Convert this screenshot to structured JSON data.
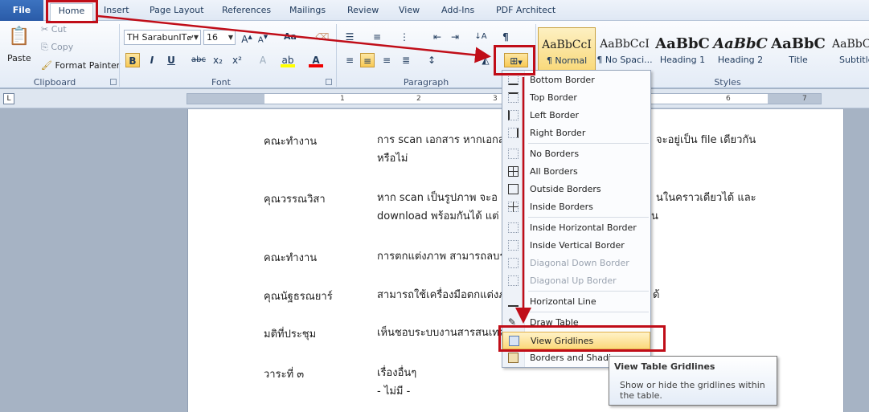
{
  "tabs": [
    "File",
    "Home",
    "Insert",
    "Page Layout",
    "References",
    "Mailings",
    "Review",
    "View",
    "Add-Ins",
    "PDF Architect"
  ],
  "clipboard": {
    "paste": "Paste",
    "cut": "Cut",
    "copy": "Copy",
    "format_painter": "Format Painter",
    "label": "Clipboard"
  },
  "font": {
    "name": "TH SarabunIT๙",
    "size": "16",
    "label": "Font",
    "bold": "B",
    "italic": "I",
    "underline": "U",
    "strike": "abc",
    "sub": "x₂",
    "sup": "x²"
  },
  "paragraph": {
    "label": "Paragraph"
  },
  "styles": {
    "label": "Styles",
    "items": [
      {
        "sample": "AaBbCcI",
        "name": "¶ Normal"
      },
      {
        "sample": "AaBbCcI",
        "name": "¶ No Spaci..."
      },
      {
        "sample": "AaBbC",
        "name": "Heading 1"
      },
      {
        "sample": "AaBbC",
        "name": "Heading 2"
      },
      {
        "sample": "AaBbC",
        "name": "Title"
      },
      {
        "sample": "AaBbC",
        "name": "Subtitle"
      }
    ]
  },
  "ruler": {
    "numbers": [
      "1",
      "2",
      "3",
      "4",
      "5",
      "6",
      "7"
    ]
  },
  "document": {
    "rows": [
      {
        "left": "คณะทำงาน",
        "right": [
          "การ scan เอกสาร หากเอกส",
          "หรือไม่"
        ],
        "right_tail": "จะอยู่เป็น file เดียวกัน"
      },
      {
        "left": "คุณวรรณวิสา",
        "right": [
          "หาก scan เป็นรูปภาพ จะอ",
          "download พร้อมกันได้ แต่"
        ],
        "right_tail": "นในคราวเดียวได้ และ",
        "right_tail2": "น"
      },
      {
        "left": "คณะทำงาน",
        "right": [
          "การตกแต่งภาพ สามารถลบร"
        ]
      },
      {
        "left": "คุณนัฐธรณยาร์",
        "right": [
          "สามารถใช้เครื่องมือตกแต่งภ"
        ],
        "right_tail": "ด้"
      },
      {
        "left": "มติที่ประชุม",
        "right": [
          "เห็นชอบระบบงานสารสนเทศ"
        ]
      },
      {
        "left": "วาระที่ ๓",
        "right": [
          "เรื่องอื่นๆ",
          "- ไม่มี -"
        ]
      }
    ]
  },
  "menu": {
    "items": [
      {
        "label": "Bottom Border",
        "disabled": false
      },
      {
        "label": "Top Border",
        "disabled": false
      },
      {
        "label": "Left Border",
        "disabled": false
      },
      {
        "label": "Right Border",
        "disabled": false
      },
      {
        "label": "No Borders",
        "disabled": false
      },
      {
        "label": "All Borders",
        "disabled": false
      },
      {
        "label": "Outside Borders",
        "disabled": false
      },
      {
        "label": "Inside Borders",
        "disabled": false
      },
      {
        "label": "Inside Horizontal Border",
        "disabled": false
      },
      {
        "label": "Inside Vertical Border",
        "disabled": false
      },
      {
        "label": "Diagonal Down Border",
        "disabled": true
      },
      {
        "label": "Diagonal Up Border",
        "disabled": true
      },
      {
        "label": "Horizontal Line",
        "disabled": false
      },
      {
        "label": "Draw Table",
        "disabled": false
      },
      {
        "label": "View Gridlines",
        "disabled": false,
        "highlighted": true
      },
      {
        "label": "Borders and Shading...",
        "disabled": false
      }
    ]
  },
  "tooltip": {
    "title": "View Table Gridlines",
    "body": "Show or hide the gridlines within the table."
  },
  "colors": {
    "annotation": "#c00d18",
    "file_tab": "#2a5ba8",
    "highlight": "#fbd97b"
  }
}
